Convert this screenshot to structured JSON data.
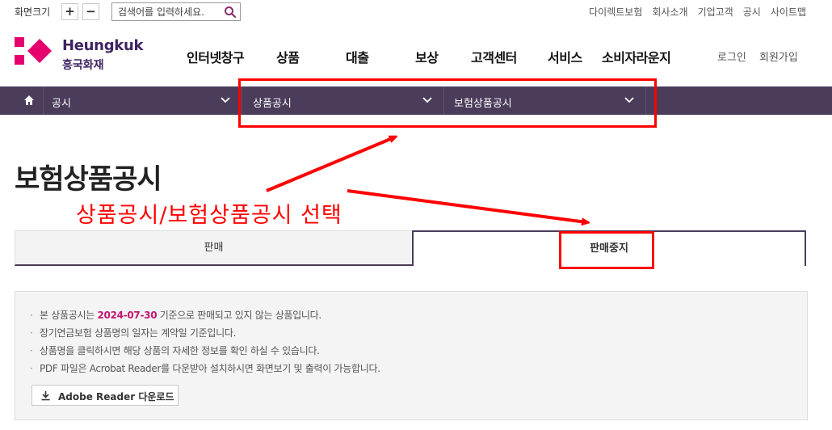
{
  "utility": {
    "zoom_label": "화면크기",
    "zoom_in": "+",
    "zoom_out": "−",
    "search_placeholder": "검색어를 입력하세요.",
    "links": [
      "다이렉트보험",
      "회사소개",
      "기업고객",
      "공시",
      "사이트맵"
    ]
  },
  "logo": {
    "name_en": "Heungkuk",
    "name_ko": "흥국화재",
    "brand_color": "#e5006d"
  },
  "gnb": {
    "items": [
      "인터넷창구",
      "상품",
      "대출",
      "보상",
      "고객센터",
      "서비스",
      "소비자라운지"
    ]
  },
  "member": {
    "login": "로그인",
    "join": "회원가입"
  },
  "breadcrumb": {
    "home_icon": "home-icon",
    "items": [
      "공시",
      "상품공시",
      "보험상품공시"
    ]
  },
  "page": {
    "title": "보험상품공시"
  },
  "annotation": {
    "text": "상품공시/보험상품공시 선택",
    "color": "#ff0000"
  },
  "tabs": {
    "items": [
      "판매",
      "판매중지"
    ],
    "active": "판매중지"
  },
  "notice": {
    "line1_prefix": "본 상품공시는 ",
    "line1_date": "2024-07-30",
    "line1_suffix": " 기준으로 판매되고 있지 않는 상품입니다.",
    "line2": "장기연금보험 상품명의 일자는 계약일 기준입니다.",
    "line3": "상품명을 클릭하시면 해당 상품의 자세한 정보를 확인 하실 수 있습니다.",
    "line4": "PDF 파일은 Acrobat Reader를 다운받아 설치하시면 화면보기 및 출력이 가능합니다.",
    "download_label": "Adobe Reader 다운로드"
  },
  "colors": {
    "accent": "#4a3c5a",
    "date": "#c4166d"
  }
}
